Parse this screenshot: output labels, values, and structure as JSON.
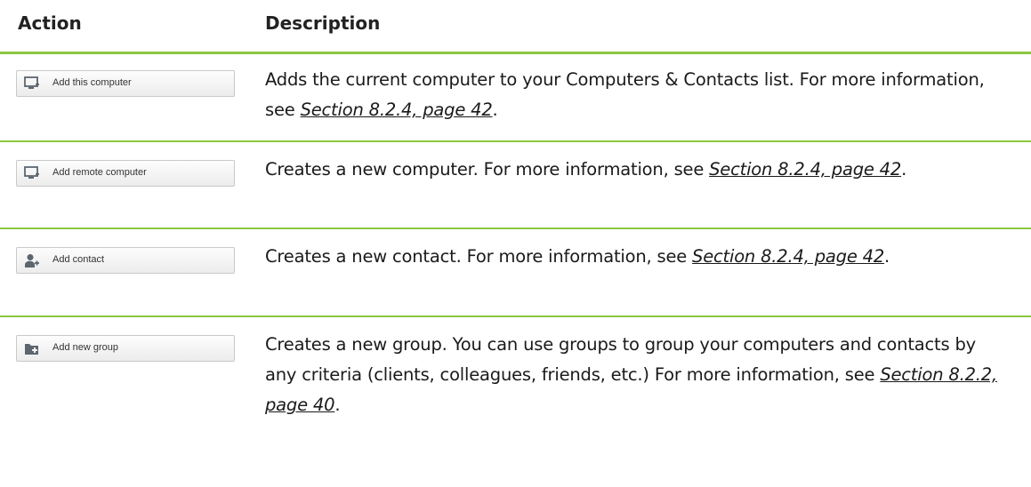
{
  "header": {
    "action": "Action",
    "description": "Description"
  },
  "rows": [
    {
      "button": "Add this computer",
      "icon": "monitor-plus-icon",
      "text_before": "Adds the current computer to your Computers & Contacts list. For more information, see ",
      "link": "Section 8.2.4, page 42",
      "text_after": "."
    },
    {
      "button": "Add remote computer",
      "icon": "monitor-plus-icon",
      "text_before": "Creates a new computer. For more information, see ",
      "link": "Section 8.2.4, page 42",
      "text_after": "."
    },
    {
      "button": "Add contact",
      "icon": "person-plus-icon",
      "text_before": "Creates a new contact. For more information, see ",
      "link": "Section 8.2.4, page 42",
      "text_after": "."
    },
    {
      "button": "Add new group",
      "icon": "folder-plus-icon",
      "text_before": "Creates a new group. You can use groups to group your computers and contacts by any criteria (clients, colleagues, friends, etc.) For more information, see ",
      "link": "Section 8.2.2, page 40",
      "text_after": "."
    }
  ],
  "colors": {
    "divider": "#8dc63f",
    "icon": "#5c6670"
  }
}
